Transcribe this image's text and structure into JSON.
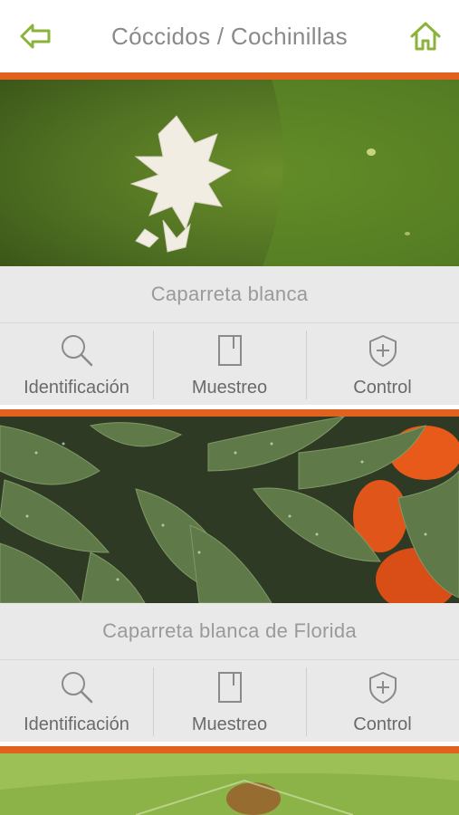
{
  "header": {
    "title": "Cóccidos / Cochinillas"
  },
  "species": [
    {
      "name": "Caparreta blanca",
      "actions": [
        {
          "label": "Identificación",
          "icon": "search-icon"
        },
        {
          "label": "Muestreo",
          "icon": "notebook-icon"
        },
        {
          "label": "Control",
          "icon": "shield-plus-icon"
        }
      ]
    },
    {
      "name": "Caparreta blanca de Florida",
      "actions": [
        {
          "label": "Identificación",
          "icon": "search-icon"
        },
        {
          "label": "Muestreo",
          "icon": "notebook-icon"
        },
        {
          "label": "Control",
          "icon": "shield-plus-icon"
        }
      ]
    }
  ],
  "colors": {
    "accent": "#e0621e",
    "icon_green": "#8bb33a",
    "panel_bg": "#e9e9e9"
  }
}
